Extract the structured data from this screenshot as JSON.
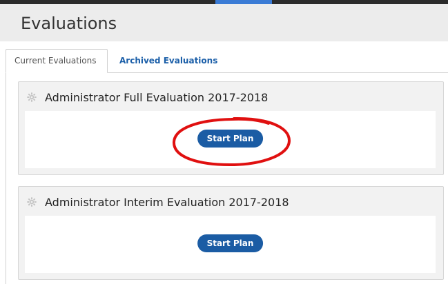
{
  "page": {
    "title": "Evaluations"
  },
  "tabs": [
    {
      "label": "Current Evaluations",
      "active": true
    },
    {
      "label": "Archived Evaluations",
      "active": false
    }
  ],
  "evaluations": [
    {
      "title": "Administrator Full Evaluation 2017-2018",
      "button_label": "Start Plan",
      "icon": "gear-icon"
    },
    {
      "title": "Administrator Interim Evaluation 2017-2018",
      "button_label": "Start Plan",
      "icon": "gear-icon"
    }
  ],
  "colors": {
    "topbar": "#2b2b2b",
    "accent": "#3a7bd5",
    "header_bg": "#ececec",
    "link": "#1a5ea8",
    "button": "#1b5ca4",
    "annotation": "#e01010"
  }
}
